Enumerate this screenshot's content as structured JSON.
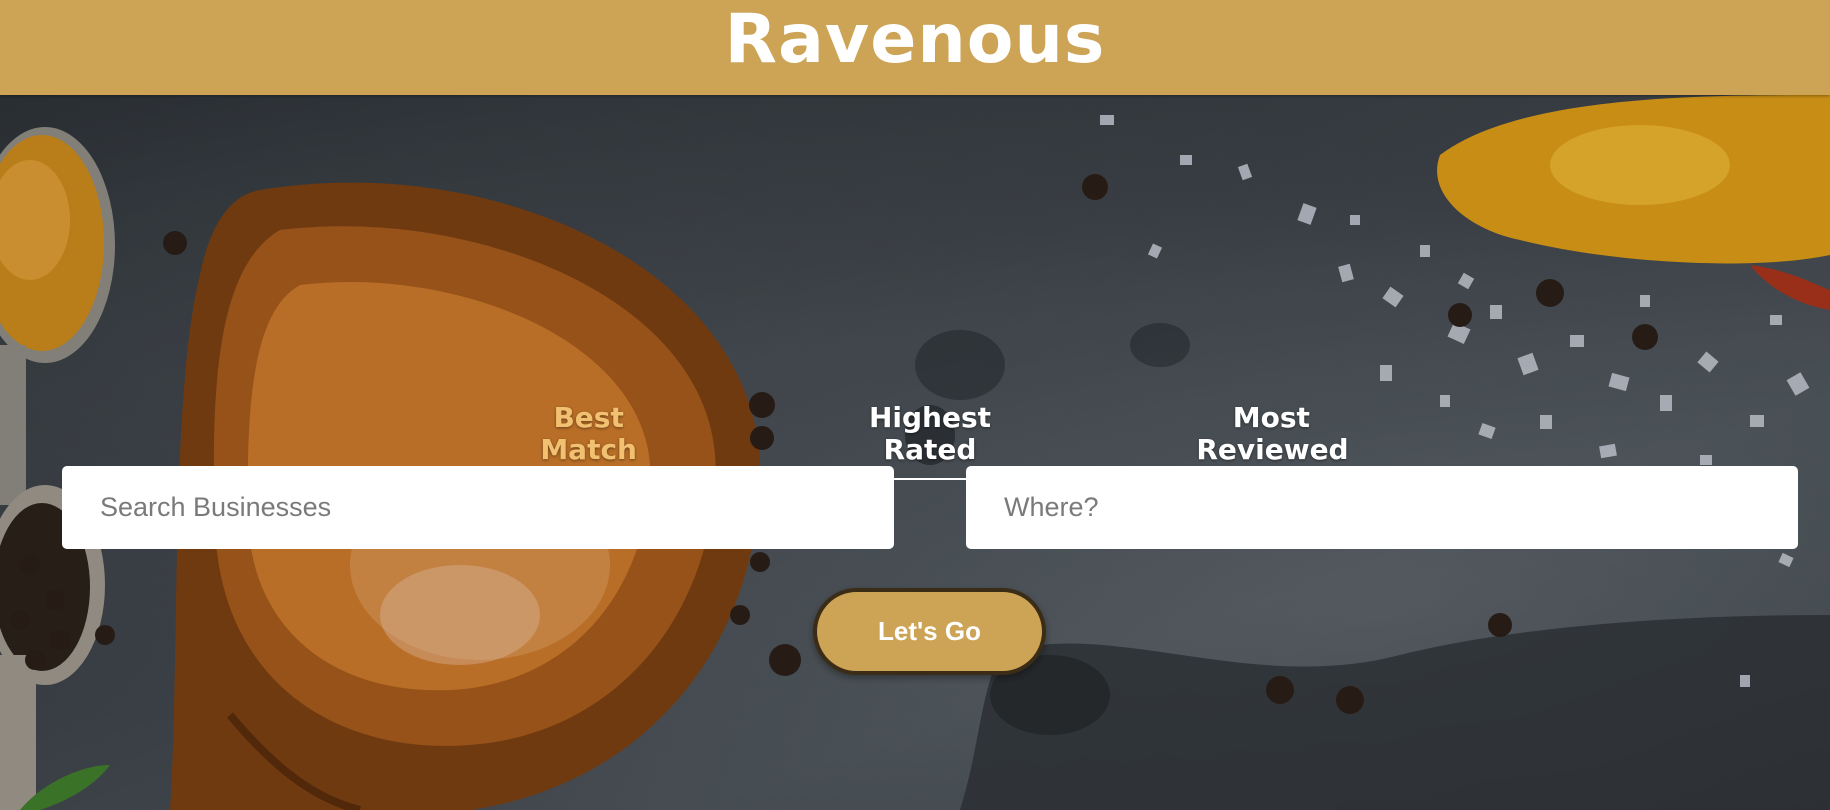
{
  "header": {
    "brand": "Ravenous"
  },
  "sort": {
    "options": [
      {
        "label": "Best Match",
        "active": true
      },
      {
        "label": "Highest Rated",
        "active": false
      },
      {
        "label": "Most Reviewed",
        "active": false
      }
    ]
  },
  "search": {
    "term_placeholder": "Search Businesses",
    "location_placeholder": "Where?",
    "submit_label": "Let's Go"
  },
  "colors": {
    "header_bg": "#cda355",
    "active_tab": "#f1c071",
    "button_bg": "#cda355"
  }
}
